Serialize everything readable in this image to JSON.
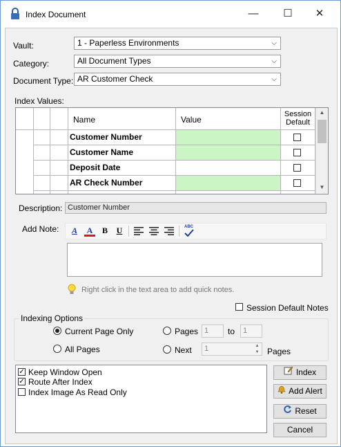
{
  "window": {
    "title": "Index Document",
    "controls": {
      "minimize": "—",
      "maximize": "☐",
      "close": "✕"
    }
  },
  "form": {
    "vault_label": "Vault:",
    "vault_value": "1 - Paperless Environments",
    "category_label": "Category:",
    "category_value": "All Document Types",
    "doctype_label": "Document Type:",
    "doctype_value": "AR Customer Check"
  },
  "index_values": {
    "label": "Index Values:",
    "columns": {
      "name": "Name",
      "value": "Value",
      "session_default": "Session Default"
    },
    "rows": [
      {
        "name": "Customer Number",
        "value": "",
        "highlight": true,
        "session_default": false
      },
      {
        "name": "Customer Name",
        "value": "",
        "highlight": true,
        "session_default": false
      },
      {
        "name": "Deposit Date",
        "value": "",
        "highlight": false,
        "session_default": false
      },
      {
        "name": "AR Check Number",
        "value": "",
        "highlight": true,
        "session_default": false
      }
    ],
    "highlight_color": "#ccf5c6"
  },
  "description": {
    "label": "Description:",
    "value": "Customer Number"
  },
  "note": {
    "label": "Add Note:",
    "toolbar": {
      "font": "A",
      "color": "A",
      "bold": "B",
      "underline": "U",
      "spell": "ABC"
    },
    "text": "",
    "hint": "Right click in the text area to add quick notes."
  },
  "session_default_notes": {
    "label": "Session Default Notes",
    "checked": false
  },
  "indexing_options": {
    "title": "Indexing Options",
    "current_page_only": {
      "label": "Current Page Only",
      "selected": true
    },
    "all_pages": {
      "label": "All Pages",
      "selected": false
    },
    "pages": {
      "label": "Pages",
      "selected": false,
      "from": "1",
      "to_label": "to",
      "to": "1"
    },
    "next": {
      "label": "Next",
      "selected": false,
      "value": "1",
      "suffix": "Pages"
    }
  },
  "options_list": [
    {
      "label": "Keep Window Open",
      "checked": true
    },
    {
      "label": "Route After Index",
      "checked": true
    },
    {
      "label": "Index Image As Read Only",
      "checked": false
    }
  ],
  "buttons": {
    "index": "Index",
    "add_alert": "Add Alert",
    "reset": "Reset",
    "cancel": "Cancel"
  }
}
